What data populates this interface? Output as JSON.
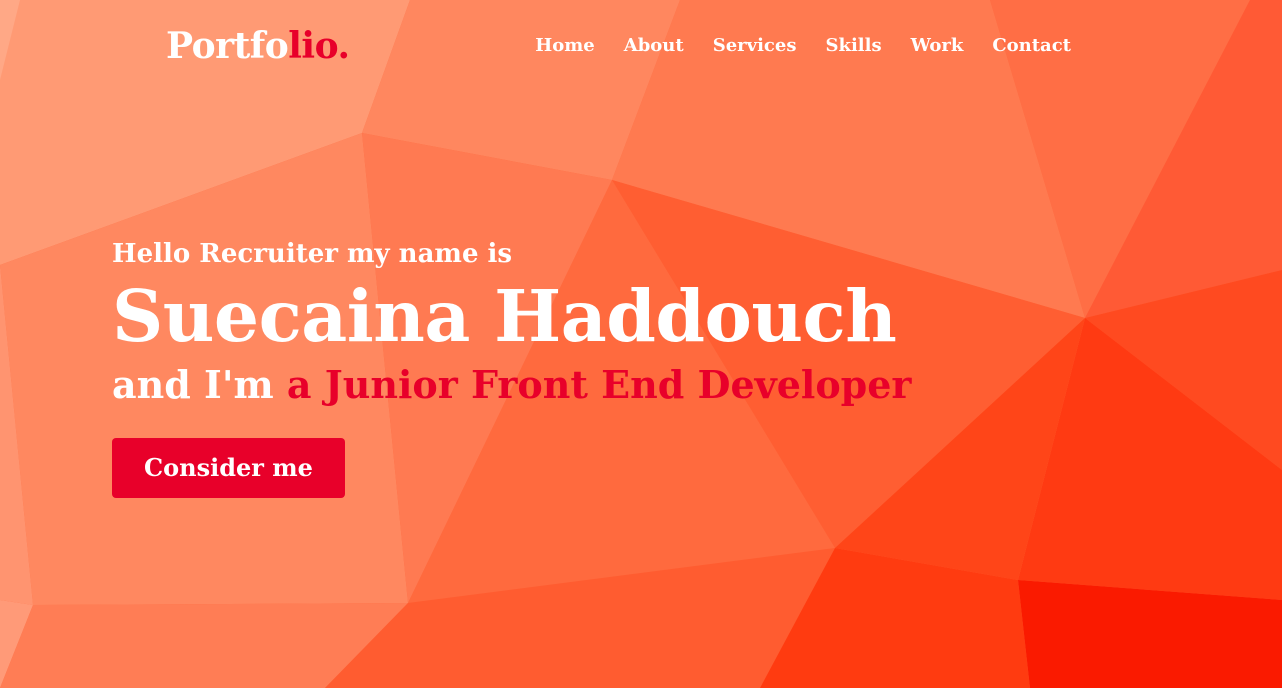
{
  "header": {
    "logo": {
      "main": "Portfo",
      "accent": "lio."
    },
    "nav": [
      {
        "label": "Home"
      },
      {
        "label": "About"
      },
      {
        "label": "Services"
      },
      {
        "label": "Skills"
      },
      {
        "label": "Work"
      },
      {
        "label": "Contact"
      }
    ]
  },
  "hero": {
    "greeting": "Hello Recruiter my name is",
    "name": "Suecaina Haddouch",
    "role_prefix": "and I'm ",
    "role_highlight": "a Junior Front End Developer",
    "cta_label": "Consider me"
  },
  "colors": {
    "accent": "#e8002a",
    "text": "#ffffff",
    "background": "#ff6a3d"
  }
}
